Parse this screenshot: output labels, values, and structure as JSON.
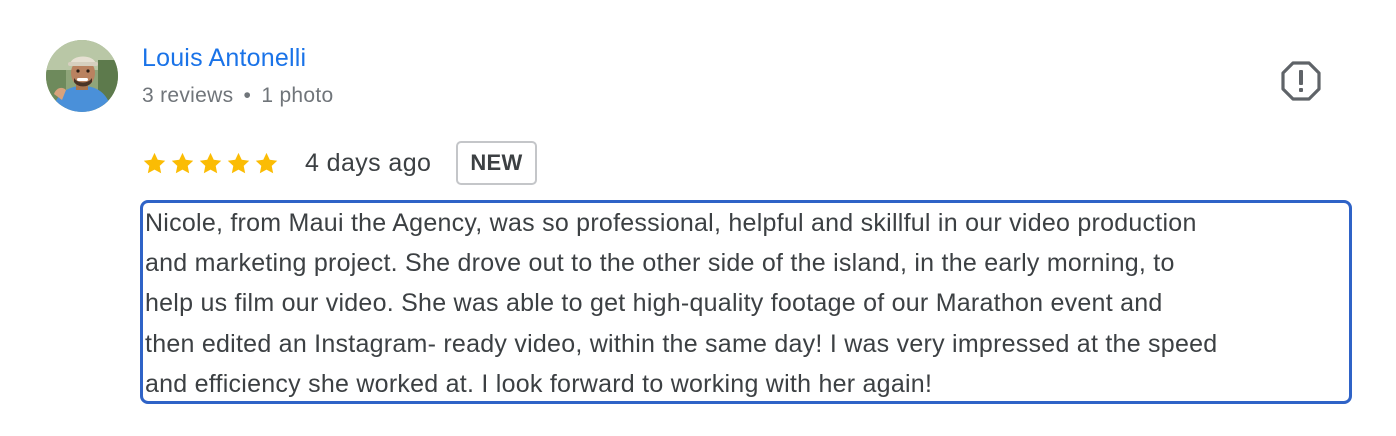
{
  "reviewer": {
    "name": "Louis Antonelli",
    "reviews": "3 reviews",
    "separator": "•",
    "photos": "1 photo"
  },
  "review": {
    "rating": 5,
    "rating_max": 5,
    "date": "4 days ago",
    "badge": "NEW",
    "lines": [
      "Nicole, from Maui the Agency, was so professional, helpful and skillful in our video production",
      "and marketing project. She drove out to the other side of the island, in the early morning, to",
      "help us film our video. She was able to get high-quality footage of our Marathon event and",
      "then edited an Instagram- ready video, within the same day! I was very impressed at the speed",
      "and efficiency she worked at. I look forward to working with her again!"
    ]
  },
  "icons": {
    "avatar": "reviewer-photo",
    "flag": "report-flag-icon",
    "star": "star-icon"
  },
  "colors": {
    "name_link": "#1a73e8",
    "star": "#fbbc04",
    "meta_text": "#70757a",
    "body_text": "#3c4043",
    "highlight_border": "#2f63c7",
    "badge_border": "#c4c6c9"
  }
}
